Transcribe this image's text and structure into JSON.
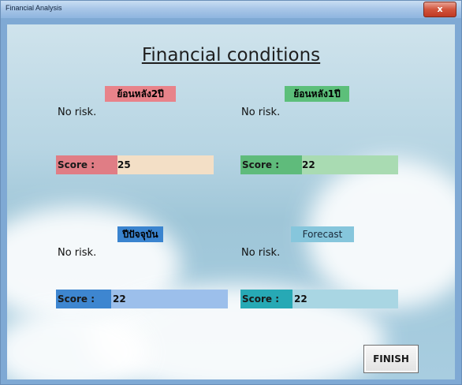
{
  "window": {
    "title": "Financial Analysis",
    "close_glyph": "x"
  },
  "heading": "Financial conditions",
  "panels": [
    {
      "label": "ย้อนหลัง2ปี",
      "risk": "No risk.",
      "score_label": "Score :",
      "score": "25",
      "badge_color": "#e8838a",
      "bar_color": "#e07d85",
      "track_color": "#f3dfc6"
    },
    {
      "label": "ย้อนหลัง1ปี",
      "risk": "No risk.",
      "score_label": "Score :",
      "score": "22",
      "badge_color": "#5cbf7a",
      "bar_color": "#5fbb7b",
      "track_color": "#a9dbb2"
    },
    {
      "label": "ปีปัจจุบัน",
      "risk": "No risk.",
      "score_label": "Score :",
      "score": "22",
      "badge_color": "#3a84cf",
      "bar_color": "#3e86d0",
      "track_color": "#9cbfeb"
    },
    {
      "label": "Forecast",
      "risk": "No risk.",
      "score_label": "Score :",
      "score": "22",
      "badge_color": "#86c6dc",
      "bar_color": "#27a9b5",
      "track_color": "#a9d6e3"
    }
  ],
  "finish_label": "FINISH"
}
